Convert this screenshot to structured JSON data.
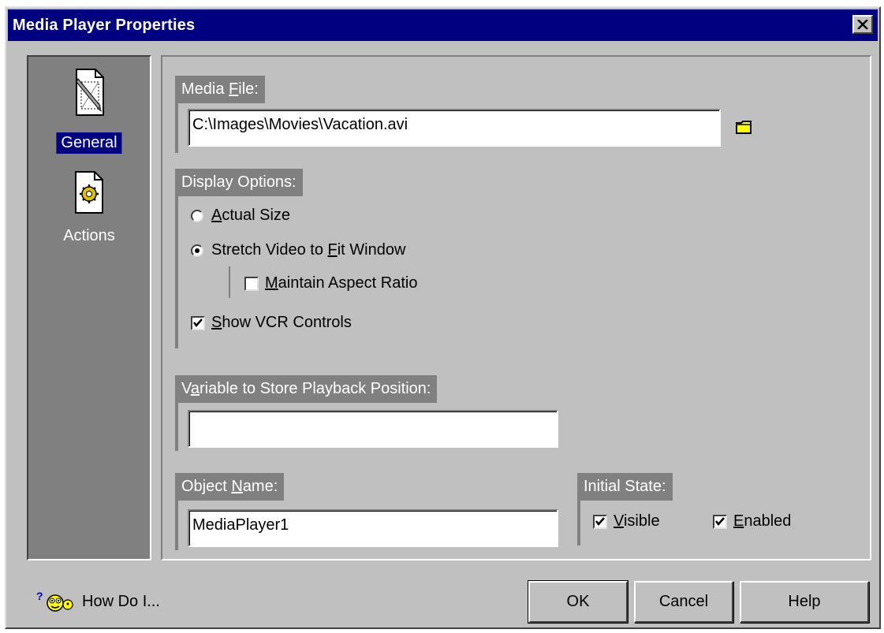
{
  "window": {
    "title": "Media Player Properties"
  },
  "sidebar": {
    "items": [
      {
        "label": "General",
        "icon": "general-page-icon",
        "selected": true
      },
      {
        "label": "Actions",
        "icon": "actions-gear-icon",
        "selected": false
      }
    ]
  },
  "media_file": {
    "label_pre": "Media ",
    "label_u": "F",
    "label_post": "ile:",
    "value": "C:\\Images\\Movies\\Vacation.avi",
    "browse_icon": "folder-icon"
  },
  "display_options": {
    "label": "Display Options:",
    "actual_size": {
      "u": "A",
      "rest": "ctual Size",
      "checked": false
    },
    "stretch": {
      "pre": "Stretch Video to ",
      "u": "F",
      "post": "it Window",
      "checked": true
    },
    "maintain_aspect": {
      "u": "M",
      "rest": "aintain Aspect Ratio",
      "checked": false
    },
    "show_vcr": {
      "u": "S",
      "rest": "how VCR Controls",
      "checked": true
    }
  },
  "playback_variable": {
    "label_pre": "V",
    "label_u": "a",
    "label_post": "riable to Store Playback Position:",
    "value": ""
  },
  "object_name": {
    "label_pre": "Object ",
    "label_u": "N",
    "label_post": "ame:",
    "value": "MediaPlayer1"
  },
  "initial_state": {
    "label": "Initial State:",
    "visible": {
      "u": "V",
      "rest": "isible",
      "checked": true
    },
    "enabled": {
      "u": "E",
      "rest": "nabled",
      "checked": true
    }
  },
  "footer": {
    "how_do_i": "How Do I...",
    "ok": "OK",
    "cancel": "Cancel",
    "help": "Help"
  },
  "colors": {
    "title_bar": "#000080",
    "dialog_face": "#c0c0c0",
    "group_label_bg": "#808080",
    "selection": "#000080"
  }
}
